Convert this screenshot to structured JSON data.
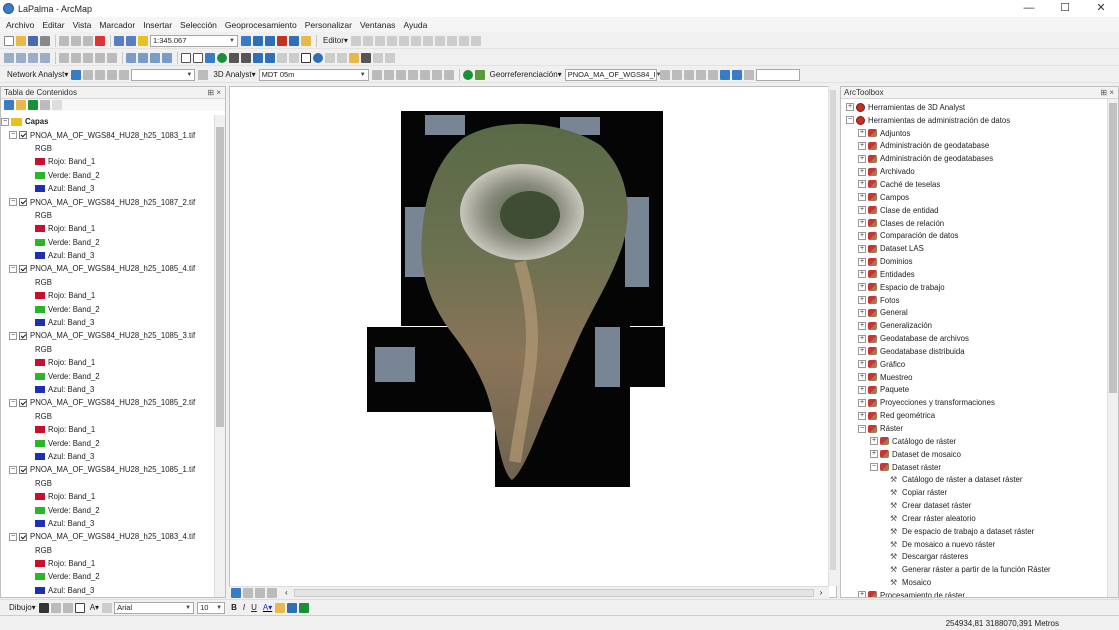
{
  "window": {
    "title": "LaPalma - ArcMap",
    "minimize": "—",
    "maximize": "☐",
    "close": "✕"
  },
  "menu": [
    "Archivo",
    "Editar",
    "Vista",
    "Marcador",
    "Insertar",
    "Selección",
    "Geoprocesamiento",
    "Personalizar",
    "Ventanas",
    "Ayuda"
  ],
  "toolbar1": {
    "scale": "1:345.067",
    "editor_label": "Editor▾"
  },
  "toolbar3": {
    "network_analyst": "Network Analyst▾",
    "analyst_3d": "3D Analyst▾",
    "layer_3d": "MDT 05m",
    "georef_label": "Georreferenciación▾",
    "georef_layer": "PNOA_MA_OF_WGS84_I"
  },
  "toc": {
    "title": "Tabla de Contenidos",
    "root_label": "Capas",
    "layers": [
      {
        "name": "PNOA_MA_OF_WGS84_HU28_h25_1083_1.tif",
        "render": "RGB",
        "bands": [
          {
            "label": "Rojo:   Band_1",
            "color": "#c8102e"
          },
          {
            "label": "Verde: Band_2",
            "color": "#2bb52b"
          },
          {
            "label": "Azul:  Band_3",
            "color": "#1c2fb5"
          }
        ]
      },
      {
        "name": "PNOA_MA_OF_WGS84_HU28_h25_1087_2.tif",
        "render": "RGB",
        "bands": [
          {
            "label": "Rojo:   Band_1",
            "color": "#c8102e"
          },
          {
            "label": "Verde: Band_2",
            "color": "#2bb52b"
          },
          {
            "label": "Azul:  Band_3",
            "color": "#1c2fb5"
          }
        ]
      },
      {
        "name": "PNOA_MA_OF_WGS84_HU28_h25_1085_4.tif",
        "render": "RGB",
        "bands": [
          {
            "label": "Rojo:   Band_1",
            "color": "#c8102e"
          },
          {
            "label": "Verde: Band_2",
            "color": "#2bb52b"
          },
          {
            "label": "Azul:  Band_3",
            "color": "#1c2fb5"
          }
        ]
      },
      {
        "name": "PNOA_MA_OF_WGS84_HU28_h25_1085_3.tif",
        "render": "RGB",
        "bands": [
          {
            "label": "Rojo:   Band_1",
            "color": "#c8102e"
          },
          {
            "label": "Verde: Band_2",
            "color": "#2bb52b"
          },
          {
            "label": "Azul:  Band_3",
            "color": "#1c2fb5"
          }
        ]
      },
      {
        "name": "PNOA_MA_OF_WGS84_HU28_h25_1085_2.tif",
        "render": "RGB",
        "bands": [
          {
            "label": "Rojo:   Band_1",
            "color": "#c8102e"
          },
          {
            "label": "Verde: Band_2",
            "color": "#2bb52b"
          },
          {
            "label": "Azul:  Band_3",
            "color": "#1c2fb5"
          }
        ]
      },
      {
        "name": "PNOA_MA_OF_WGS84_HU28_h25_1085_1.tif",
        "render": "RGB",
        "bands": [
          {
            "label": "Rojo:   Band_1",
            "color": "#c8102e"
          },
          {
            "label": "Verde: Band_2",
            "color": "#2bb52b"
          },
          {
            "label": "Azul:  Band_3",
            "color": "#1c2fb5"
          }
        ]
      },
      {
        "name": "PNOA_MA_OF_WGS84_HU28_h25_1083_4.tif",
        "render": "RGB",
        "bands": [
          {
            "label": "Rojo:   Band_1",
            "color": "#c8102e"
          },
          {
            "label": "Verde: Band_2",
            "color": "#2bb52b"
          },
          {
            "label": "Azul:  Band_3",
            "color": "#1c2fb5"
          }
        ]
      }
    ]
  },
  "arctoolbox": {
    "title": "ArcToolbox",
    "toolboxes": [
      {
        "label": "Herramientas de 3D Analyst",
        "expanded": false
      },
      {
        "label": "Herramientas de administración de datos",
        "expanded": true
      }
    ],
    "toolsets": [
      "Adjuntos",
      "Administración de geodatabase",
      "Administración de geodatabases",
      "Archivado",
      "Caché de teselas",
      "Campos",
      "Clase de entidad",
      "Clases de relación",
      "Comparación de datos",
      "Dataset LAS",
      "Dominios",
      "Entidades",
      "Espacio de trabajo",
      "Fotos",
      "General",
      "Generalización",
      "Geodatabase de archivos",
      "Geodatabase distribuida",
      "Gráfico",
      "Muestreo",
      "Paquete",
      "Proyecciones y transformaciones",
      "Red geométrica",
      "Ráster"
    ],
    "raster_children": [
      "Catálogo de ráster",
      "Dataset de mosaico",
      "Dataset ráster"
    ],
    "dataset_raster_tools": [
      "Catálogo de ráster a dataset ráster",
      "Copiar ráster",
      "Crear dataset ráster",
      "Crear ráster aleatorio",
      "De espacio de trabajo a dataset ráster",
      "De mosaico a nuevo ráster",
      "Descargar rásteres",
      "Generar ráster a partir de la función Ráster",
      "Mosaico"
    ],
    "last_item": "Procesamiento de ráster"
  },
  "drawing": {
    "label": "Dibujo▾",
    "font": "Arial",
    "size": "10"
  },
  "status": {
    "coords": "254934,81  3188070,391 Metros"
  },
  "colors": {
    "accent": "#3a7bc8",
    "highlight": "#cce4f7"
  }
}
